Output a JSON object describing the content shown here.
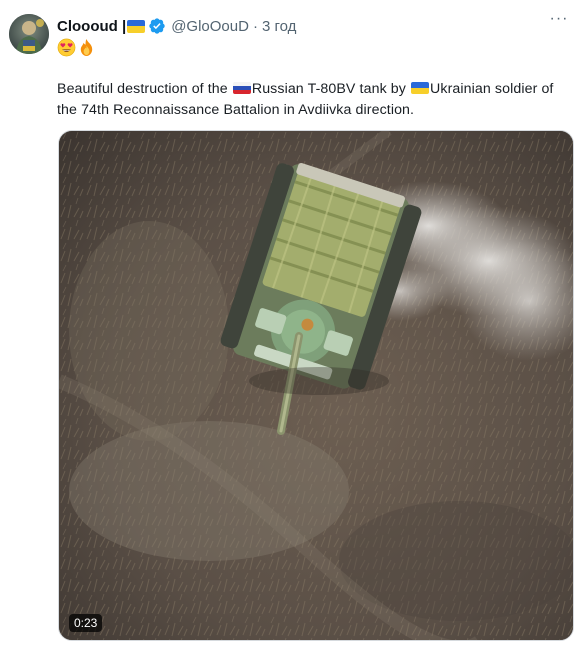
{
  "author": {
    "display_name": "Cloooud |",
    "handle": "@GloOouD",
    "separator": "·",
    "time": "3 год",
    "avatar_icon": "avatar-image",
    "name_flag_icon": "ukraine-flag-icon",
    "verified_icon": "verified-badge-icon",
    "emojis": [
      "heart-eyes-emoji",
      "fire-emoji"
    ]
  },
  "more_label": "···",
  "tweet": {
    "part1": "Beautiful destruction of the ",
    "part2": "Russian T-80BV tank by ",
    "part3": "Ukrainian soldier of the 74th Reconnaissance Battalion in Avdiivka direction.",
    "flags": [
      "russia-flag-icon",
      "ukraine-flag-icon"
    ]
  },
  "media": {
    "type": "video",
    "duration": "0:23"
  },
  "colors": {
    "accent": "#1d9bf0",
    "secondary_text": "#536471",
    "primary_text": "#0f1419"
  }
}
